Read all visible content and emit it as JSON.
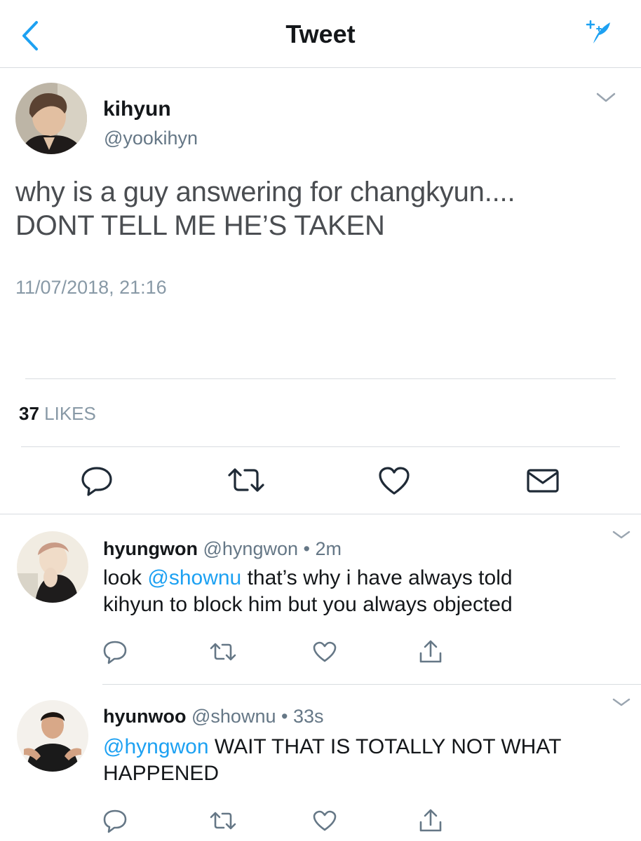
{
  "nav": {
    "title": "Tweet"
  },
  "tweet": {
    "display_name": "kihyun",
    "handle": "@yookihyn",
    "text_line1": "why is a guy answering for changkyun....",
    "text_line2": "DONT TELL ME HE’S TAKEN",
    "timestamp": "11/07/2018, 21:16",
    "likes_count": "37",
    "likes_label": "LIKES"
  },
  "replies": [
    {
      "display_name": "hyungwon",
      "handle": "@hyngwon",
      "separator": "•",
      "time": "2m",
      "line1_prefix": "look ",
      "line1_mention": "@shownu",
      "line1_suffix": " that’s why i have always told",
      "line2": "kihyun to block him but you always objected"
    },
    {
      "display_name": "hyunwoo",
      "handle": "@shownu",
      "separator": "•",
      "time": "33s",
      "line1_mention": "@hyngwon",
      "line1_suffix": " WAIT THAT IS TOTALLY NOT WHAT",
      "line2": "HAPPENED"
    }
  ],
  "colors": {
    "accent": "#1da1f2",
    "text": "#14171a",
    "secondary": "#8899a6",
    "icon": "#657786",
    "divider": "#d8dce0"
  },
  "icons": {
    "back": "chevron-left-icon",
    "compose": "compose-sparkle-icon",
    "reply": "reply-bubble-icon",
    "retweet": "retweet-icon",
    "like": "heart-icon",
    "dm": "envelope-icon",
    "share": "share-icon",
    "caret": "chevron-down-icon"
  }
}
